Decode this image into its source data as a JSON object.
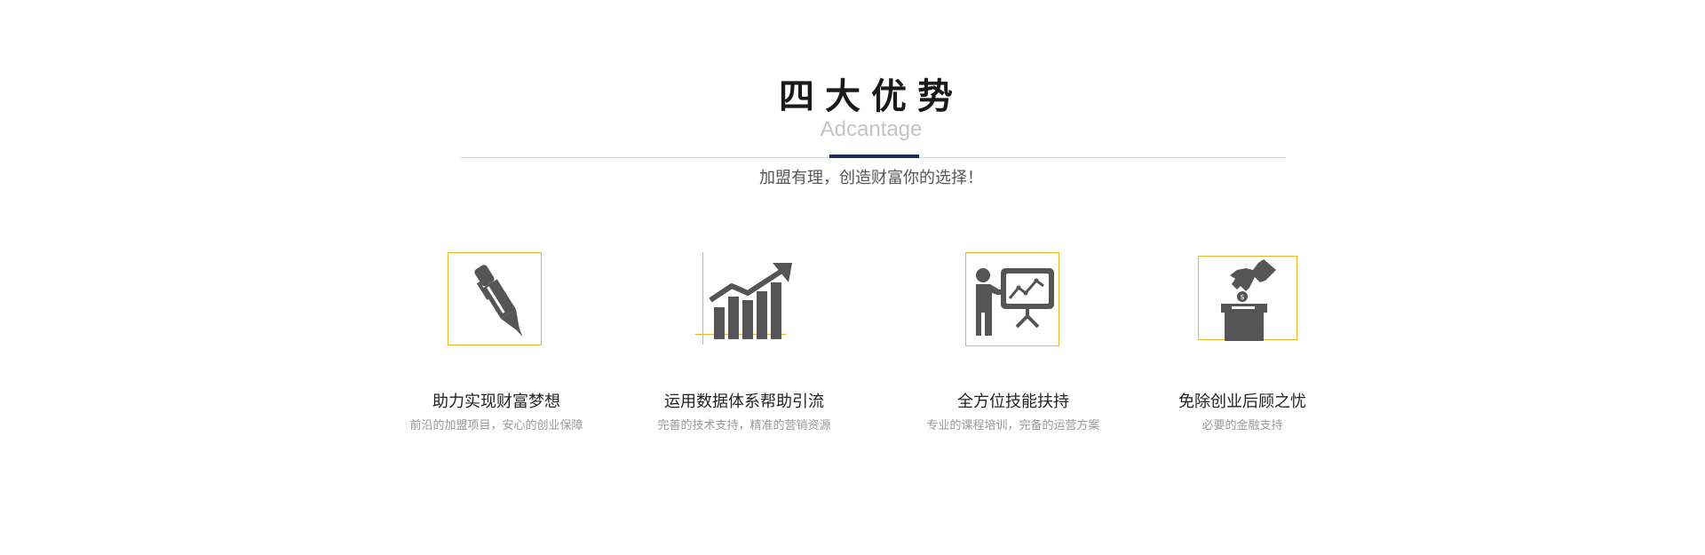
{
  "section": {
    "title": "四大优势",
    "subtitle": "Adcantage",
    "tagline": "加盟有理，创造财富你的选择！"
  },
  "colors": {
    "accent": "#1a2a5e",
    "frame": "#f0b429",
    "icon": "#555555"
  },
  "advantages": [
    {
      "icon": "pen-icon",
      "title": "助力实现财富梦想",
      "desc": "前沿的加盟项目，安心的创业保障"
    },
    {
      "icon": "growth-chart-icon",
      "title": "运用数据体系帮助引流",
      "desc": "完善的技术支持，精准的营销资源"
    },
    {
      "icon": "presentation-icon",
      "title": "全方位技能扶持",
      "desc": "专业的课程培训，完备的运营方案"
    },
    {
      "icon": "coin-box-icon",
      "title": "免除创业后顾之忧",
      "desc": "必要的金融支持"
    }
  ]
}
